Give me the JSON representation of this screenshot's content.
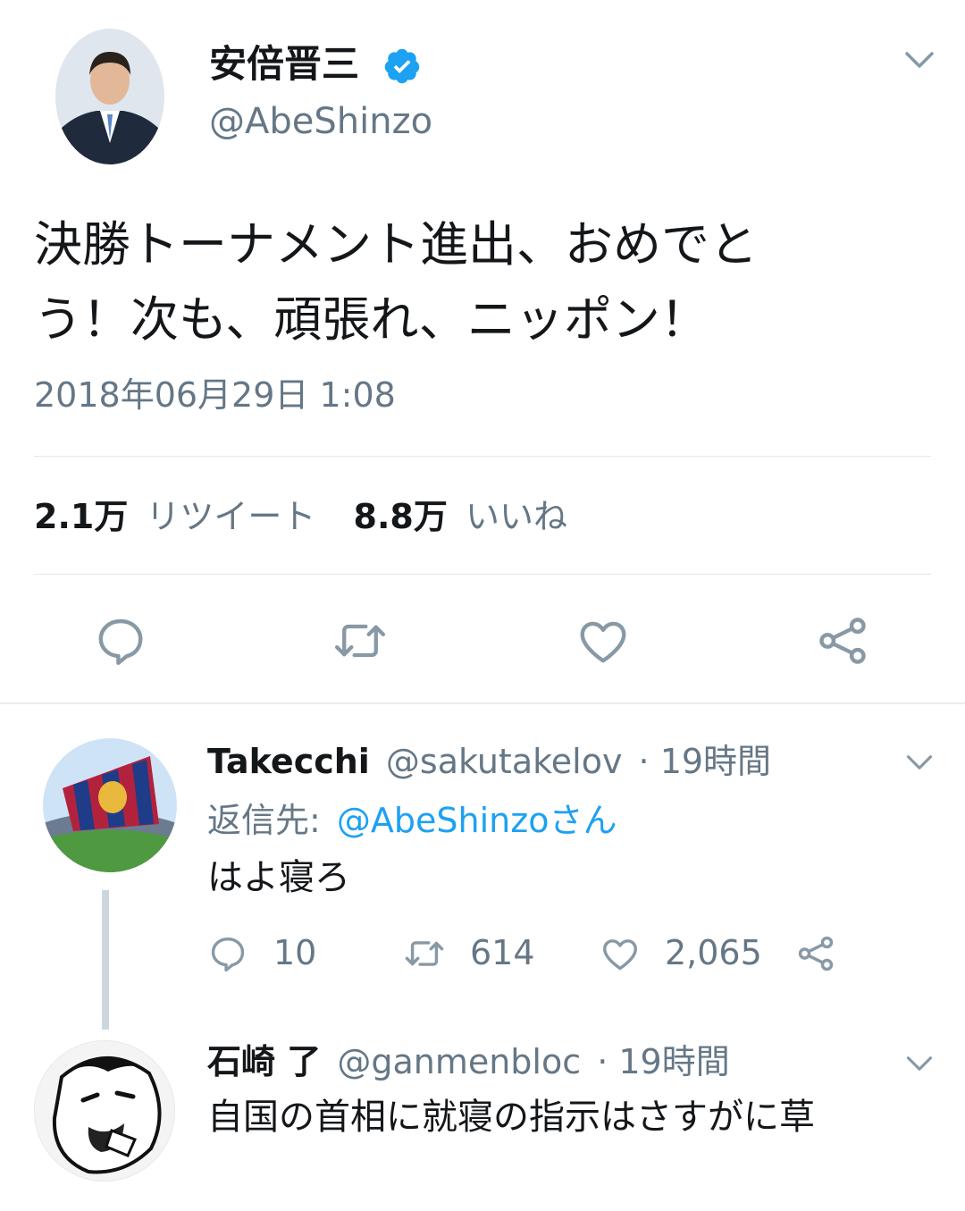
{
  "tweet": {
    "display_name": "安倍晋三",
    "handle": "@AbeShinzo",
    "text_line1": "決勝トーナメント進出、おめでと",
    "text_line2": "う！次も、頑張れ、ニッポン！",
    "timestamp": "2018年06月29日 1:08",
    "retweet_count": "2.1万",
    "retweet_label": "リツイート",
    "like_count": "8.8万",
    "like_label": "いいね",
    "verified": true
  },
  "replies": [
    {
      "display_name": "Takecchi",
      "handle": "@sakutakelov",
      "time": "· 19時間",
      "reply_to_label": "返信先:",
      "reply_to_handle": "@AbeShinzoさん",
      "text": "はよ寝ろ",
      "reply_count": "10",
      "retweet_count": "614",
      "like_count": "2,065"
    },
    {
      "display_name": "石崎 了",
      "handle": "@ganmenbloc",
      "time": "· 19時間",
      "text": "自国の首相に就寝の指示はさすがに草"
    }
  ],
  "colors": {
    "accent": "#1da1f2",
    "muted": "#657786",
    "icon": "#8899a6",
    "divider": "#e1e8ed",
    "thread_line": "#ccd6dd"
  },
  "icons": [
    "chevron-down-icon",
    "verified-badge-icon",
    "reply-icon",
    "retweet-icon",
    "like-icon",
    "share-icon"
  ]
}
